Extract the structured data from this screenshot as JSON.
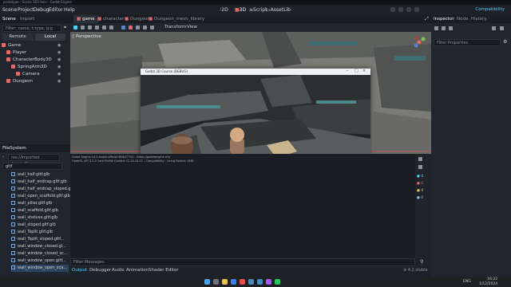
{
  "window": {
    "title": "prototype - Scene 3D1.tscn - Godot Engine"
  },
  "menu": [
    "Scene",
    "Project",
    "Debug",
    "Editor",
    "Help"
  ],
  "workspaces": [
    "2D",
    "3D",
    "Script",
    "AssetLib"
  ],
  "renderer": "Compatibility",
  "scene_dock": {
    "tabs": [
      "Scene",
      "Import"
    ],
    "filter_placeholder": "Filter: name, t:type, g:g",
    "modes": [
      "Remote",
      "Local"
    ],
    "tree": [
      {
        "label": "Game",
        "icon": "node3d-icon",
        "color": "#e36b6b"
      },
      {
        "label": "Player",
        "icon": "node3d-icon",
        "color": "#e36b6b"
      },
      {
        "label": "CharacterBody3D",
        "icon": "body-icon",
        "color": "#e36b6b"
      },
      {
        "label": "SpringArm3D",
        "icon": "springarm-icon",
        "color": "#e36b6b"
      },
      {
        "label": "Camera",
        "icon": "camera-icon",
        "color": "#e36b6b"
      },
      {
        "label": "Dungeon",
        "icon": "node3d-icon",
        "color": "#e36b6b"
      }
    ]
  },
  "filesystem": {
    "title": "FileSystem",
    "path": "res://Imported Assets/Du",
    "filter": "gltf",
    "files": [
      "wall_half.gltf.glb",
      "wall_half_endcap.gltf.glb",
      "wall_half_endcap_sloped.gltf",
      "wall_open_scaffold.gltf.glb",
      "wall_pillar.gltf.glb",
      "wall_scaffold.gltf.glb",
      "wall_shelves.gltf.glb",
      "wall_sloped.gltf.glb",
      "wall_Tsplit.gltf.glb",
      "wall_Tsplit_sloped.gltf...",
      "wall_window_closed.gl...",
      "wall_window_closed_sc...",
      "wall_window_open.gltf...",
      "wall_window_open_sca..."
    ]
  },
  "editor_tabs": [
    "game",
    "character",
    "Dungeon",
    "Dungeon_mesh_library"
  ],
  "viewport": {
    "toolbar": [
      "Transform",
      "View"
    ],
    "perspective_label": "[ Perspective"
  },
  "game_window": {
    "title": "Godot 3D Course (DEBUG)"
  },
  "output": {
    "lines": [
      "Godot Engine v4.2.stable.official.46dc27791 - https://godotengine.org",
      "OpenGL API 3.3.0 Core Profile Context 22.20.44.12 - Compatibility - Using Device: AMD"
    ],
    "filter_placeholder": "Filter Messages",
    "tabs": [
      "Output",
      "Debugger",
      "Audio",
      "Animation",
      "Shader Editor"
    ],
    "version": "4.2.stable",
    "counts": [
      "0",
      "0",
      "0",
      "0"
    ]
  },
  "inspector": {
    "tabs": [
      "Inspector",
      "Node",
      "History"
    ],
    "filter_placeholder": "Filter Properties"
  },
  "taskbar": {
    "lang": "ENG",
    "time": "16:22",
    "date": "1/12/2024"
  },
  "colors": {
    "accent": "#4fd3ff",
    "panel": "#21262e",
    "background": "#1d2229"
  }
}
